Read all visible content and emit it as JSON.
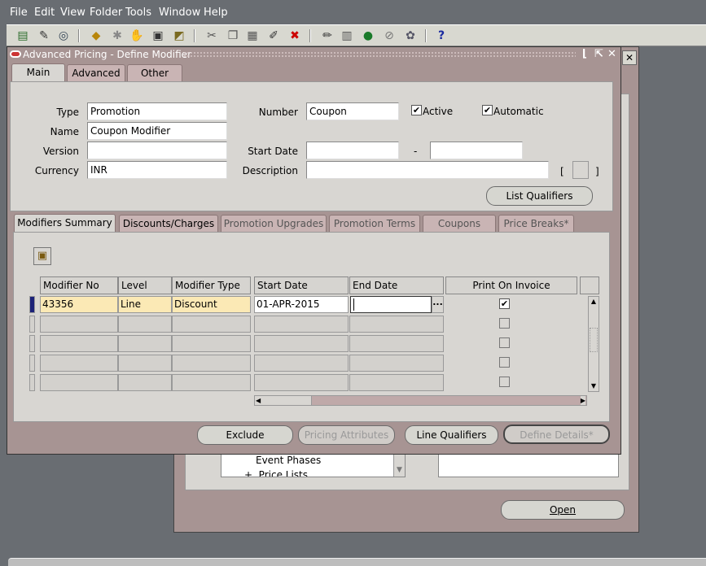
{
  "menu": [
    "File",
    "Edit",
    "View",
    "Folder",
    "Tools",
    "Window",
    "Help"
  ],
  "toolbar_icons": [
    "new-icon",
    "find-icon",
    "navigator-icon",
    "save-icon",
    "next-step-icon",
    "switch-responsibility-icon",
    "print-icon",
    "close-form-icon",
    "cut-icon",
    "copy-icon",
    "paste-icon",
    "new-record-icon",
    "delete-record-icon",
    "edit-field-icon",
    "zoom-icon",
    "translations-icon",
    "attachments-icon",
    "folder-tools-icon",
    "help-icon"
  ],
  "window": {
    "title": "Advanced Pricing - Define Modifier",
    "tabs": [
      "Main",
      "Advanced",
      "Other"
    ],
    "active_tab": "Main"
  },
  "header": {
    "type_label": "Type",
    "type_value": "Promotion",
    "name_label": "Name",
    "name_value": "Coupon Modifier",
    "version_label": "Version",
    "version_value": "",
    "currency_label": "Currency",
    "currency_value": "INR",
    "number_label": "Number",
    "number_value": "Coupon",
    "active_label": "Active",
    "active_checked": true,
    "automatic_label": "Automatic",
    "automatic_checked": true,
    "start_date_label": "Start Date",
    "start_date_value": "",
    "date_separator": "-",
    "end_date_value": "",
    "description_label": "Description",
    "description_value": "",
    "bracket_open": "[",
    "bracket_close": "]",
    "list_qualifiers_button": "List Qualifiers"
  },
  "lines_tabs": [
    "Modifiers Summary",
    "Discounts/Charges",
    "Promotion Upgrades",
    "Promotion Terms",
    "Coupons",
    "Price Breaks*"
  ],
  "lines_table": {
    "columns": [
      "Modifier No",
      "Level",
      "Modifier Type",
      "Start Date",
      "End Date",
      "Print On Invoice"
    ],
    "rows": [
      {
        "modifier_no": "43356",
        "level": "Line",
        "modifier_type": "Discount",
        "start_date": "01-APR-2015",
        "end_date": "",
        "print_on_invoice": true
      },
      {
        "modifier_no": "",
        "level": "",
        "modifier_type": "",
        "start_date": "",
        "end_date": "",
        "print_on_invoice": false
      },
      {
        "modifier_no": "",
        "level": "",
        "modifier_type": "",
        "start_date": "",
        "end_date": "",
        "print_on_invoice": false
      },
      {
        "modifier_no": "",
        "level": "",
        "modifier_type": "",
        "start_date": "",
        "end_date": "",
        "print_on_invoice": false
      },
      {
        "modifier_no": "",
        "level": "",
        "modifier_type": "",
        "start_date": "",
        "end_date": "",
        "print_on_invoice": false
      }
    ],
    "lov_button": "..."
  },
  "buttons": {
    "exclude": "Exclude",
    "pricing_attributes": "Pricing Attributes",
    "line_qualifiers": "Line Qualifiers",
    "define_details": "Define Details*"
  },
  "back_window": {
    "list_items": [
      "Event Phases",
      "+  Price Lists"
    ],
    "open_button": "Open"
  },
  "colors": {
    "desktop": "#696d72",
    "window_frame": "#a79493",
    "panel": "#d8d6d2",
    "required_field": "#fbe9b5",
    "current_record": "#1c2278"
  }
}
